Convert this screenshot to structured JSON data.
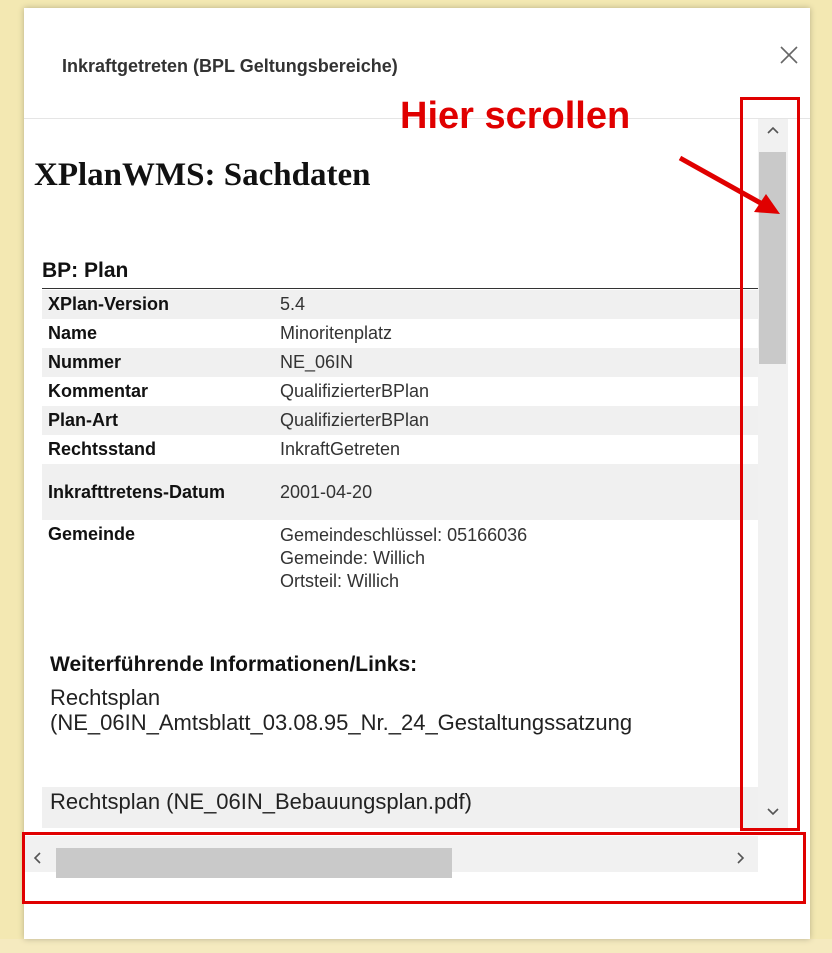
{
  "dialog": {
    "title": "Inkraftgetreten (BPL Geltungsbereiche)",
    "close_icon": "close-icon"
  },
  "content": {
    "heading": "XPlanWMS: Sachdaten",
    "subheading": "BP: Plan",
    "attributes": [
      {
        "label": "XPlan-Version",
        "value": "5.4"
      },
      {
        "label": "Name",
        "value": "Minoritenplatz"
      },
      {
        "label": "Nummer",
        "value": "NE_06IN"
      },
      {
        "label": "Kommentar",
        "value": "QualifizierterBPlan"
      },
      {
        "label": "Plan-Art",
        "value": "QualifizierterBPlan"
      },
      {
        "label": "Rechtsstand",
        "value": "InkraftGetreten"
      },
      {
        "label": "Inkrafttretens-Datum",
        "value": "2001-04-20"
      },
      {
        "label": "Gemeinde",
        "value_lines": [
          "Gemeindeschlüssel: 05166036",
          "Gemeinde: Willich",
          "Ortsteil: Willich"
        ]
      }
    ],
    "links_heading": "Weiterführende Informationen/Links:",
    "links": [
      {
        "label_line1": "Rechtsplan",
        "label_line2": "(NE_06IN_Amtsblatt_03.08.95_Nr._24_Gestaltungssatzung"
      },
      {
        "label": "Rechtsplan (NE_06IN_Bebauungsplan.pdf)"
      }
    ]
  },
  "scrollbars": {
    "vertical": {
      "up_icon": "chevron-up-icon",
      "down_icon": "chevron-down-icon",
      "position": 0.0
    },
    "horizontal": {
      "left_icon": "chevron-left-icon",
      "right_icon": "chevron-right-icon",
      "position": 0.0
    }
  },
  "annotation": {
    "label": "Hier scrollen",
    "color": "#e00000"
  }
}
